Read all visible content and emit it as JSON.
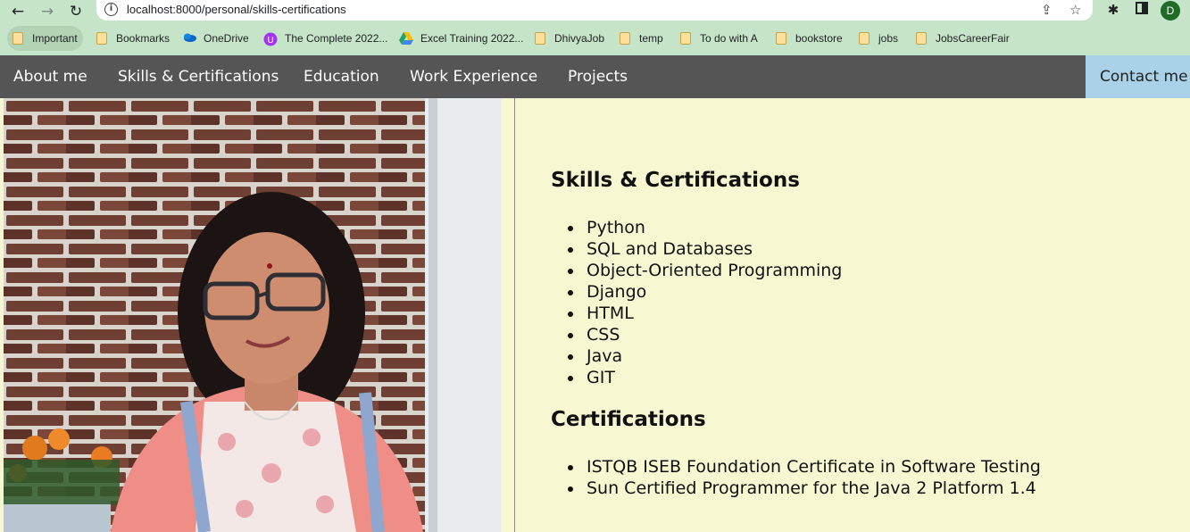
{
  "browser": {
    "url": "localhost:8000/personal/skills-certifications",
    "bookmarks": [
      {
        "label": "Important",
        "icon": "folder-icon"
      },
      {
        "label": "Bookmarks",
        "icon": "folder-icon"
      },
      {
        "label": "OneDrive",
        "icon": "onedrive-icon"
      },
      {
        "label": "The Complete 2022...",
        "icon": "udemy-icon"
      },
      {
        "label": "Excel Training 2022...",
        "icon": "google-drive-icon"
      },
      {
        "label": "DhivyaJob",
        "icon": "folder-icon"
      },
      {
        "label": "temp",
        "icon": "folder-icon"
      },
      {
        "label": "To do with A",
        "icon": "folder-icon"
      },
      {
        "label": "bookstore",
        "icon": "folder-icon"
      },
      {
        "label": "jobs",
        "icon": "folder-icon"
      },
      {
        "label": "JobsCareerFair",
        "icon": "folder-icon"
      }
    ],
    "profile_initial": "D"
  },
  "nav": {
    "about": "About me",
    "skills": "Skills & Certifications",
    "education": "Education",
    "work": "Work Experience",
    "projects": "Projects",
    "contact": "Contact me"
  },
  "skills": {
    "heading": "Skills & Certifications",
    "items": [
      "Python",
      "SQL and Databases",
      "Object-Oriented Programming",
      "Django",
      "HTML",
      "CSS",
      "Java",
      "GIT"
    ]
  },
  "certifications": {
    "heading": "Certifications",
    "items": [
      "ISTQB ISEB Foundation Certificate in Software Testing",
      "Sun Certified Programmer for the Java 2 Platform 1.4"
    ]
  },
  "colors": {
    "nav_bg": "#555555",
    "contact_bg": "#a9d2e8",
    "content_bg": "#f7f8d2",
    "chrome_bg": "#c6e5c8"
  }
}
